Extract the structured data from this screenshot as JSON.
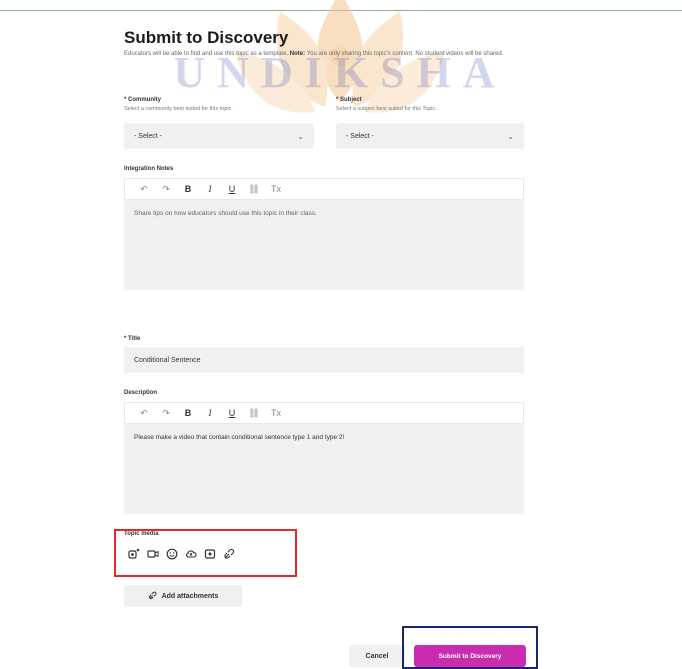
{
  "form": {
    "title": "Submit to Discovery",
    "description_lead": "Educators will be able to find and use this topic as a template.",
    "description_note_label": "Note:",
    "description_note": "You are only sharing this topic's content. No student videos will be shared."
  },
  "community": {
    "label": "* Community",
    "hint": "Select a community best suited for this topic.",
    "selected": "- Select -"
  },
  "subject": {
    "label": "* Subject",
    "hint": "Select a subject best suited for this Topic.",
    "selected": "- Select -"
  },
  "integration_notes": {
    "label": "Integration Notes",
    "placeholder": "Share tips on how educators should use this topic in their class."
  },
  "toolbar": {
    "undo": "↶",
    "redo": "↷",
    "bold": "B",
    "italic": "I",
    "underline": "U",
    "link": "⛓",
    "clear_format": "Tx"
  },
  "title_field": {
    "label": "* Title",
    "value": "Conditional Sentence"
  },
  "description_field": {
    "label": "Description",
    "value": "Please make a video that contain conditional sentence type 1 and type 2!"
  },
  "topic_media": {
    "label": "Topic media",
    "icons": [
      "record-video-icon",
      "video-camera-icon",
      "emoji-icon",
      "cloud-upload-icon",
      "screen-record-icon",
      "link-icon"
    ]
  },
  "attachments": {
    "label": "Add attachments"
  },
  "actions": {
    "cancel": "Cancel",
    "submit": "Submit to Discovery"
  },
  "watermark": {
    "text": "UNDIKSHA"
  },
  "colors": {
    "submit_button": "#c92cae",
    "highlight_red": "#e8272a",
    "highlight_blue": "#1c2370",
    "field_bg": "#f0f0f0"
  }
}
